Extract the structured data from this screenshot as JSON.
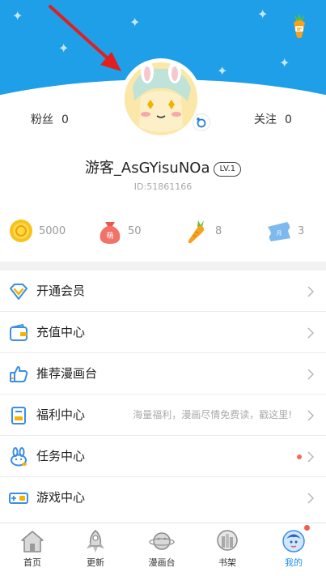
{
  "profile": {
    "fans_label": "粉丝",
    "fans_count": "0",
    "follow_label": "关注",
    "follow_count": "0",
    "username": "游客_AsGYisuNOa",
    "level": "LV.1",
    "user_id": "ID:51861166"
  },
  "currencies": [
    {
      "icon": "coin-icon",
      "value": "5000"
    },
    {
      "icon": "cute-bag-icon",
      "value": "50"
    },
    {
      "icon": "carrot-icon",
      "value": "8"
    },
    {
      "icon": "ticket-icon",
      "value": "3"
    }
  ],
  "menu": [
    {
      "icon": "diamond-icon",
      "label": "开通会员",
      "hint": ""
    },
    {
      "icon": "wallet-icon",
      "label": "充值中心",
      "hint": ""
    },
    {
      "icon": "thumbs-up-icon",
      "label": "推荐漫画台",
      "hint": ""
    },
    {
      "icon": "gift-card-icon",
      "label": "福利中心",
      "hint": "海量福利，漫画尽情免费读，戳这里!"
    },
    {
      "icon": "bunny-icon",
      "label": "任务中心",
      "hint": ""
    },
    {
      "icon": "gamepad-icon",
      "label": "游戏中心",
      "hint": ""
    }
  ],
  "tabs": [
    {
      "icon": "home-icon",
      "label": "首页"
    },
    {
      "icon": "rocket-icon",
      "label": "更新"
    },
    {
      "icon": "planet-icon",
      "label": "漫画台"
    },
    {
      "icon": "bookshelf-icon",
      "label": "书架"
    },
    {
      "icon": "profile-icon",
      "label": "我的"
    }
  ],
  "colors": {
    "banner": "#1f9fe8",
    "active_tab": "#1e90e8",
    "notification_dot": "#f25b4e",
    "annotation_arrow": "#e02020"
  }
}
